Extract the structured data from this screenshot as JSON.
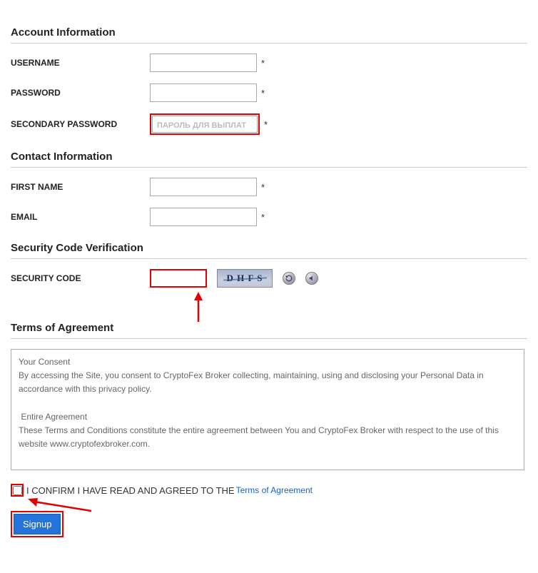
{
  "sections": {
    "account": "Account Information",
    "contact": "Contact Information",
    "security": "Security Code Verification",
    "terms": "Terms of Agreement"
  },
  "labels": {
    "username": "USERNAME",
    "password": "PASSWORD",
    "secondary_password": "SECONDARY PASSWORD",
    "first_name": "FIRST NAME",
    "email": "EMAIL",
    "security_code": "SECURITY CODE"
  },
  "placeholders": {
    "secondary_password": "ПАРОЛЬ ДЛЯ ВЫПЛАТ"
  },
  "required_mark": "*",
  "captcha": {
    "text": "D H F S"
  },
  "terms_text": "Your Consent\nBy accessing the Site, you consent to CryptoFex Broker collecting, maintaining, using and disclosing your Personal Data in accordance with this privacy policy.\n\n Entire Agreement\nThese Terms and Conditions constitute the entire agreement between You and CryptoFex Broker with respect to the use of this website www.cryptofexbroker.com.",
  "confirm": {
    "text": "I CONFIRM I HAVE READ AND AGREED TO THE",
    "link": "Terms of Agreement"
  },
  "signup": "Signup"
}
